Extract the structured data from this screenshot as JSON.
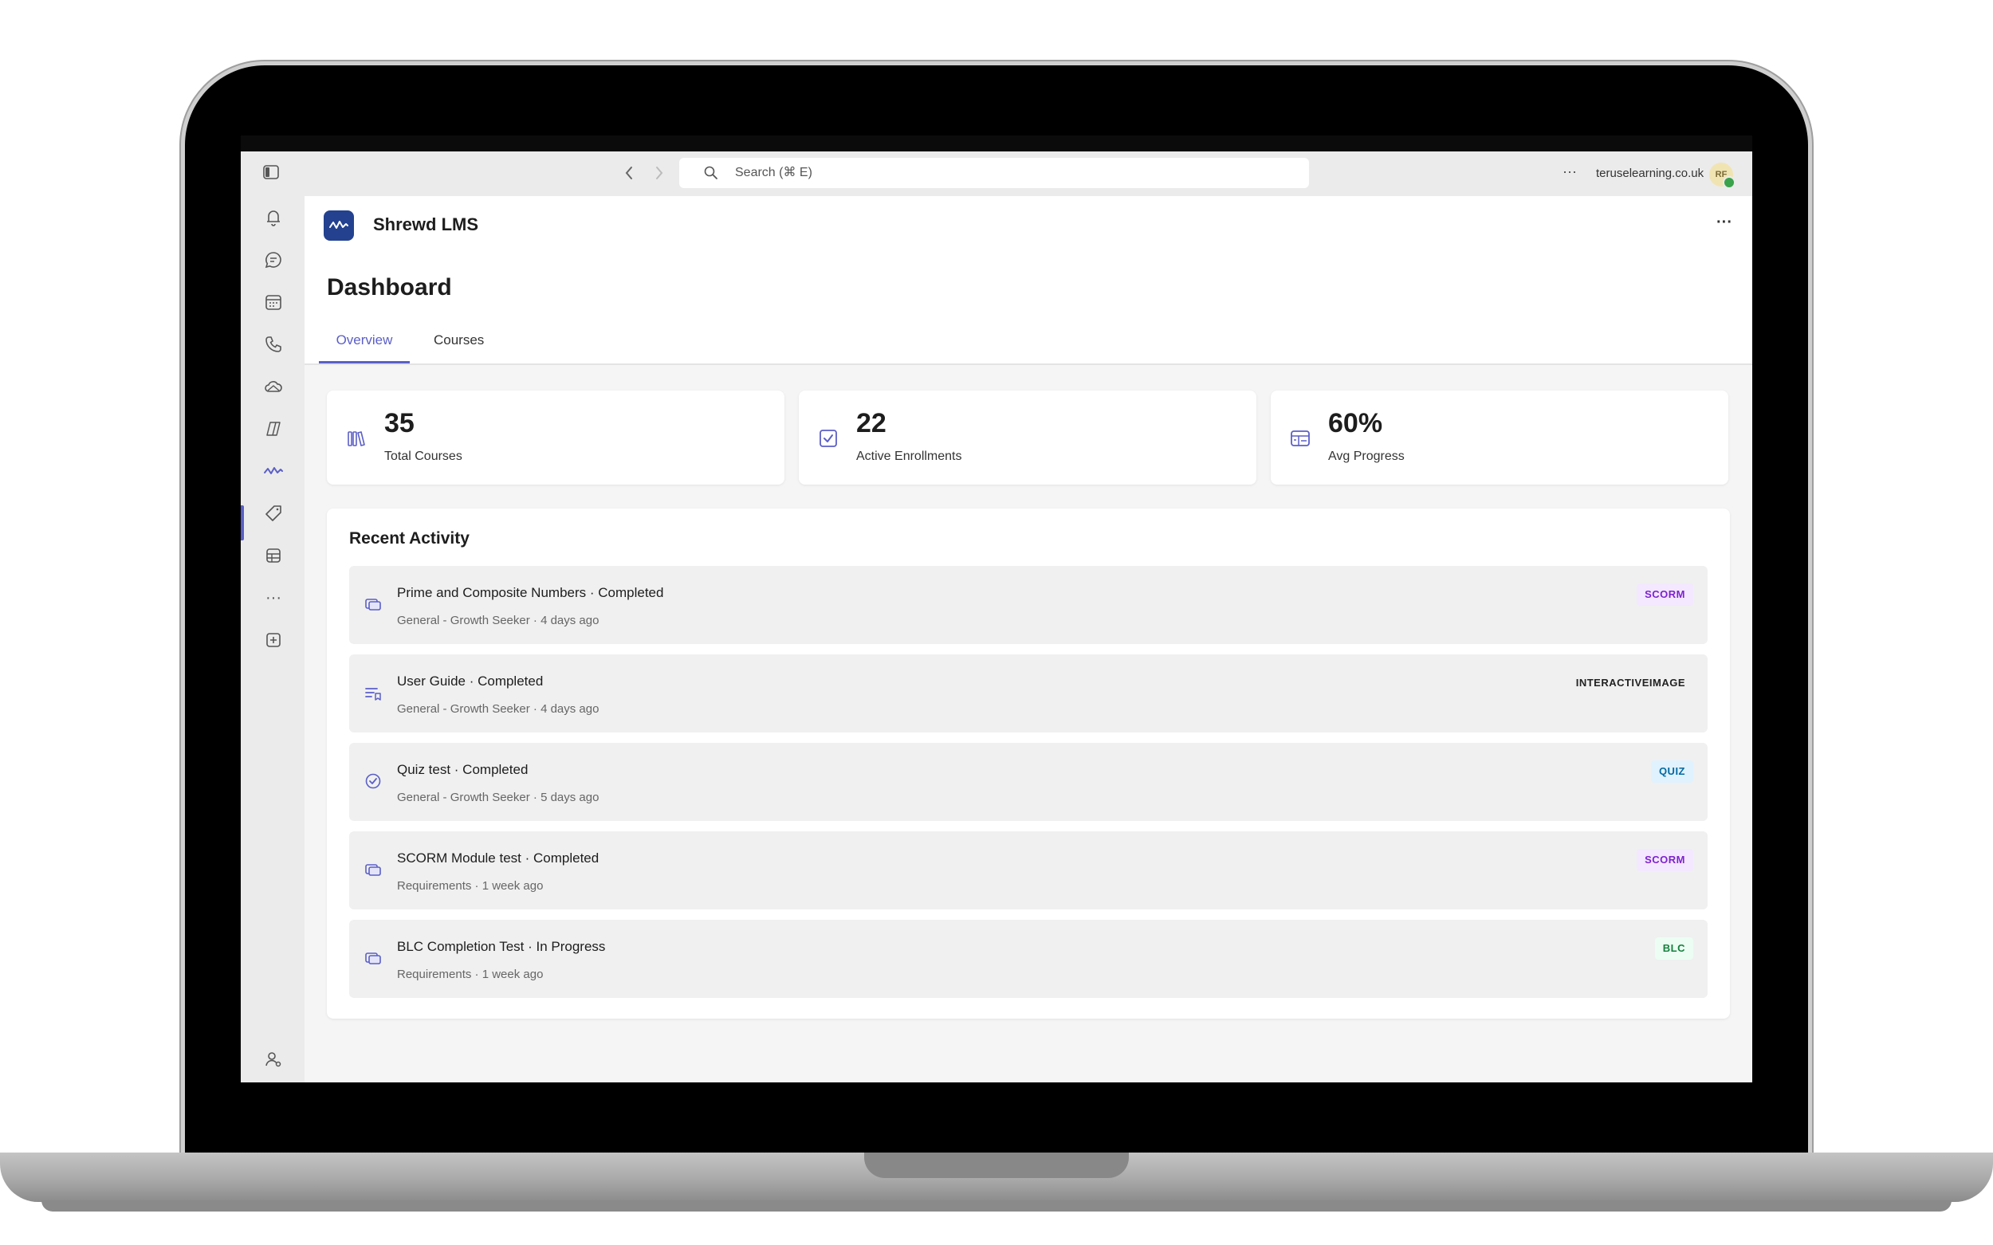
{
  "titlebar": {
    "search_placeholder": "Search (⌘ E)",
    "domain": "teruselearning.co.uk",
    "avatar_initials": "RF"
  },
  "rail": {
    "items": [
      "activity-icon",
      "chat-icon",
      "calendar-icon",
      "calls-icon",
      "onedrive-icon",
      "copilot-icon",
      "shrewd-lms-icon",
      "tag-icon",
      "apps-icon",
      "more-icon",
      "add-app-icon"
    ],
    "active": "shrewd-lms-icon"
  },
  "app": {
    "name": "Shrewd LMS",
    "more_label": "···"
  },
  "page": {
    "title": "Dashboard",
    "tabs": [
      {
        "label": "Overview",
        "active": true
      },
      {
        "label": "Courses",
        "active": false
      }
    ]
  },
  "stats": [
    {
      "value": "35",
      "label": "Total Courses",
      "icon": "books-icon"
    },
    {
      "value": "22",
      "label": "Active Enrollments",
      "icon": "checkbox-icon"
    },
    {
      "value": "60%",
      "label": "Avg Progress",
      "icon": "progress-board-icon"
    }
  ],
  "activity": {
    "title": "Recent Activity",
    "items": [
      {
        "title": "Prime and Composite Numbers · Completed",
        "subtitle": "General - Growth Seeker · 4 days ago",
        "badge": "SCORM",
        "icon": "module-icon"
      },
      {
        "title": "User Guide · Completed",
        "subtitle": "General - Growth Seeker · 4 days ago",
        "badge": "INTERACTIVEIMAGE",
        "icon": "guide-list-icon"
      },
      {
        "title": "Quiz test · Completed",
        "subtitle": "General - Growth Seeker · 5 days ago",
        "badge": "QUIZ",
        "icon": "check-circle-icon"
      },
      {
        "title": "SCORM Module test · Completed",
        "subtitle": "Requirements · 1 week ago",
        "badge": "SCORM",
        "icon": "module-icon"
      },
      {
        "title": "BLC Completion Test · In Progress",
        "subtitle": "Requirements · 1 week ago",
        "badge": "BLC",
        "icon": "module-icon"
      }
    ]
  },
  "colors": {
    "accent": "#5b5fc7",
    "logo_bg": "#23418f",
    "scorm": "#7e22ce",
    "quiz": "#0369a1",
    "blc": "#15803d"
  }
}
